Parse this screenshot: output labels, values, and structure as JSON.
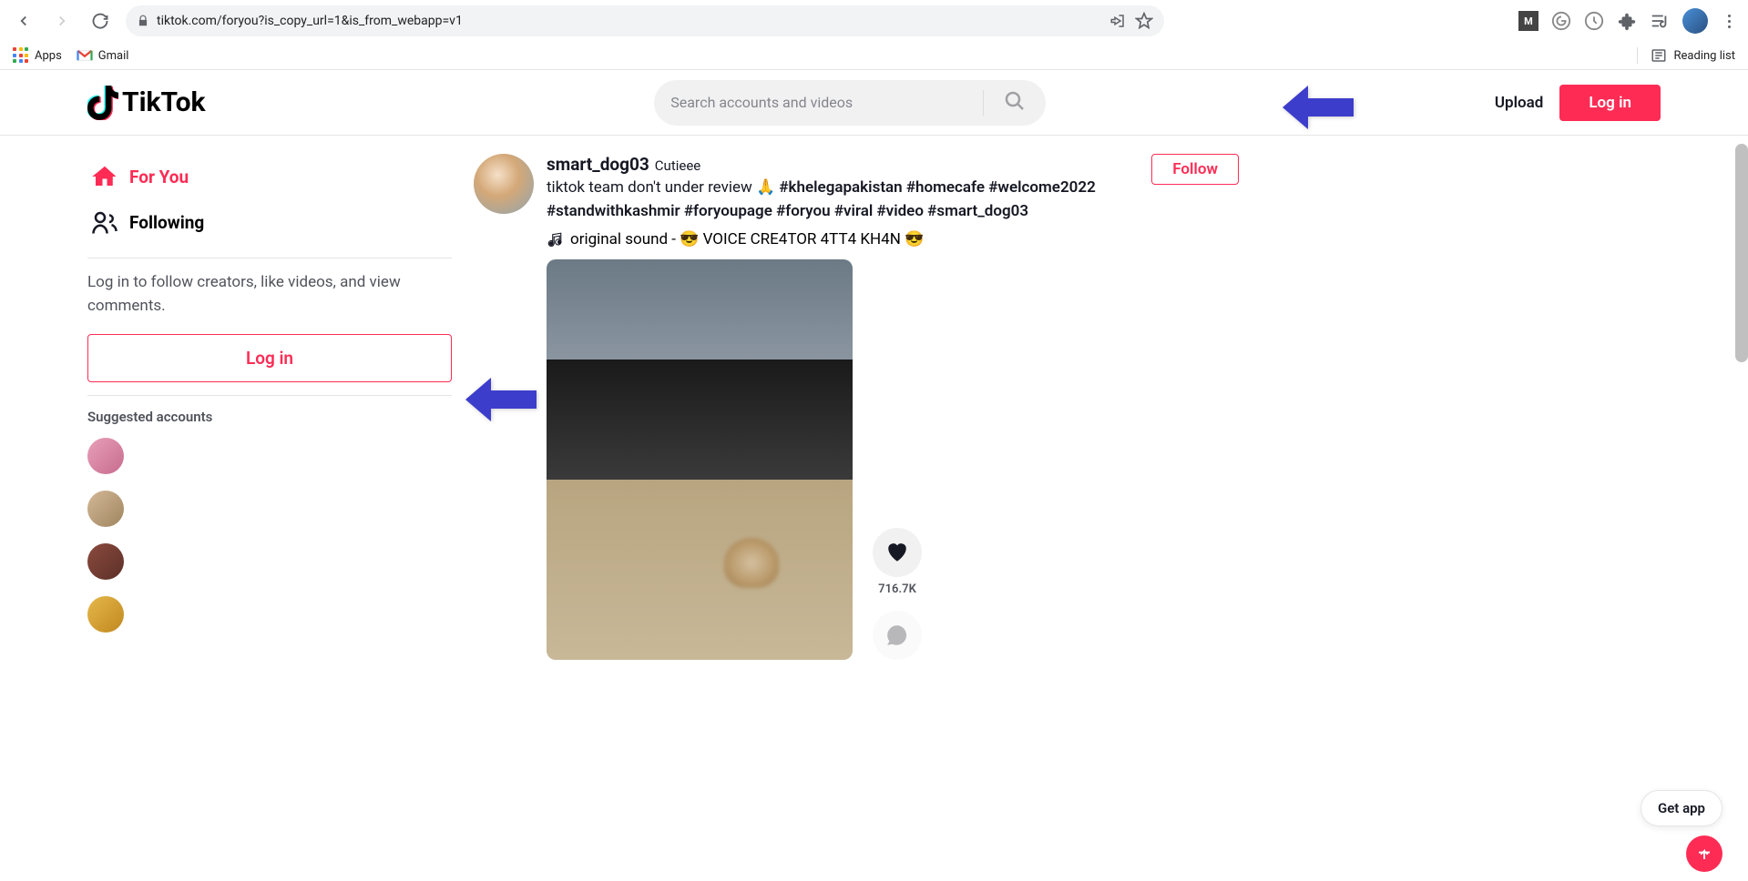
{
  "browser": {
    "url": "tiktok.com/foryou?is_copy_url=1&is_from_webapp=v1",
    "bookmarks": {
      "apps": "Apps",
      "gmail": "Gmail"
    },
    "reading_list": "Reading list"
  },
  "header": {
    "logo_text": "TikTok",
    "search_placeholder": "Search accounts and videos",
    "upload": "Upload",
    "login": "Log in"
  },
  "sidebar": {
    "for_you": "For You",
    "following": "Following",
    "login_prompt": "Log in to follow creators, like videos, and view comments.",
    "login": "Log in",
    "suggested_title": "Suggested accounts"
  },
  "post": {
    "username": "smart_dog03",
    "nickname": "Cutieee",
    "description_pre": "tiktok team don't under review 🙏 ",
    "hashtags": "#khelegapakistan #homecafe #welcome2022 #standwithkashmir #foryoupage #foryou #viral #video #smart_dog03",
    "music": "original sound - 😎 VOICE CRE4TOR 4TT4 KH4N 😎",
    "follow": "Follow",
    "like_count": "716.7K"
  },
  "floating": {
    "get_app": "Get app"
  }
}
